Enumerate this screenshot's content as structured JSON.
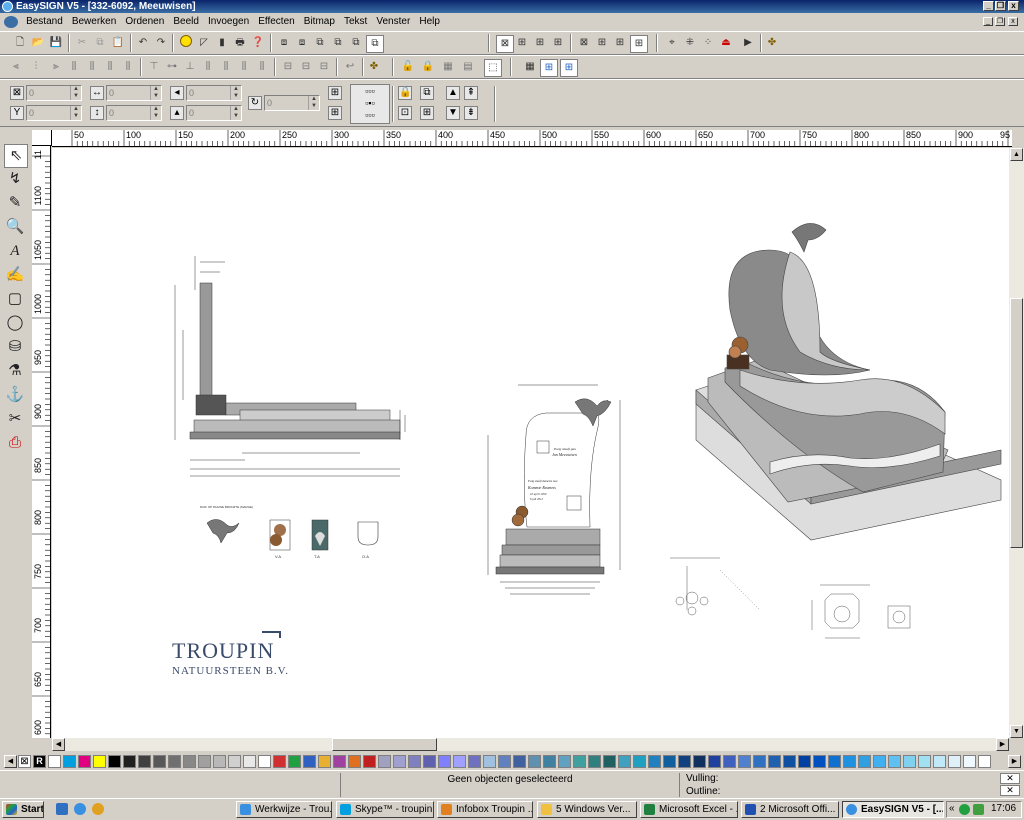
{
  "window": {
    "title": "EasySIGN V5 - [332-6092, Meeuwisen]"
  },
  "menu": {
    "items": [
      "Bestand",
      "Bewerken",
      "Ordenen",
      "Beeld",
      "Invoegen",
      "Effecten",
      "Bitmap",
      "Tekst",
      "Venster",
      "Help"
    ]
  },
  "props": {
    "x_value": "0",
    "y_value": "0",
    "w_value": "0",
    "h_value": "0",
    "x2_value": "0",
    "y2_value": "0",
    "rotate_value": "0"
  },
  "ruler": {
    "h": [
      "50",
      "100",
      "150",
      "200",
      "250",
      "300",
      "350",
      "400",
      "450",
      "500",
      "550",
      "600",
      "650",
      "700",
      "750",
      "800",
      "850",
      "900",
      "95"
    ],
    "v": [
      "11",
      "1100",
      "1050",
      "1000",
      "950",
      "900",
      "850",
      "800",
      "750",
      "700",
      "650",
      "600"
    ]
  },
  "drawing": {
    "brand_name": "TROUPIN",
    "brand_sub": "NATUURSTEEN B.V.",
    "stone_text_line1": "Ewig slaaft gau",
    "stone_text_line2": "Jan Meeuwisen",
    "stone_text_line3": "Ewig slaaft dameste nau",
    "stone_text_line4": "Kommie Reumeis",
    "stone_text_line5": "10 april 1950",
    "stone_text_line6": "6 juli 2012"
  },
  "palette_colors": [
    "#ffffff",
    "#00a0e0",
    "#e00080",
    "#ffff00",
    "#000000",
    "#202020",
    "#404040",
    "#585858",
    "#707070",
    "#888888",
    "#a0a0a0",
    "#b8b8b8",
    "#d0d0d0",
    "#e8e8e8",
    "#ffffff",
    "#d03030",
    "#20a040",
    "#3060c0",
    "#e8b030",
    "#a040a0",
    "#e07020",
    "#c02020",
    "#a0a0c0",
    "#a0a0d0",
    "#8080c0",
    "#6060b0",
    "#8080ff",
    "#a0a0ff",
    "#7070c0",
    "#a0c0e0",
    "#6080c0",
    "#4060a0",
    "#6090b0",
    "#4080a0",
    "#60a0c0",
    "#40a0a0",
    "#308080",
    "#206060",
    "#40a0c0",
    "#20a0c0",
    "#2080c0",
    "#1060a0",
    "#104080",
    "#103060",
    "#2040a0",
    "#4060c0",
    "#5080d0",
    "#3070c0",
    "#2060b0",
    "#1050a0",
    "#0040a0",
    "#0050c0",
    "#1070d0",
    "#2090e0",
    "#30a0e0",
    "#40b0f0",
    "#60c0f0",
    "#80d0f0",
    "#a0e0f0",
    "#c0e8f8",
    "#e0f0f8",
    "#f0f8ff",
    "#ffffff"
  ],
  "status": {
    "selection": "Geen objecten geselecteerd",
    "fill_label": "Vulling:",
    "outline_label": "Outline:"
  },
  "taskbar": {
    "start": "Start",
    "tasks": [
      "Werkwijze - Trou...",
      "Skype™ - troupin...",
      "Infobox Troupin ...",
      "5 Windows Ver...",
      "Microsoft Excel - ...",
      "2 Microsoft Offi...",
      "EasySIGN V5 - [..."
    ],
    "clock": "17:06"
  }
}
